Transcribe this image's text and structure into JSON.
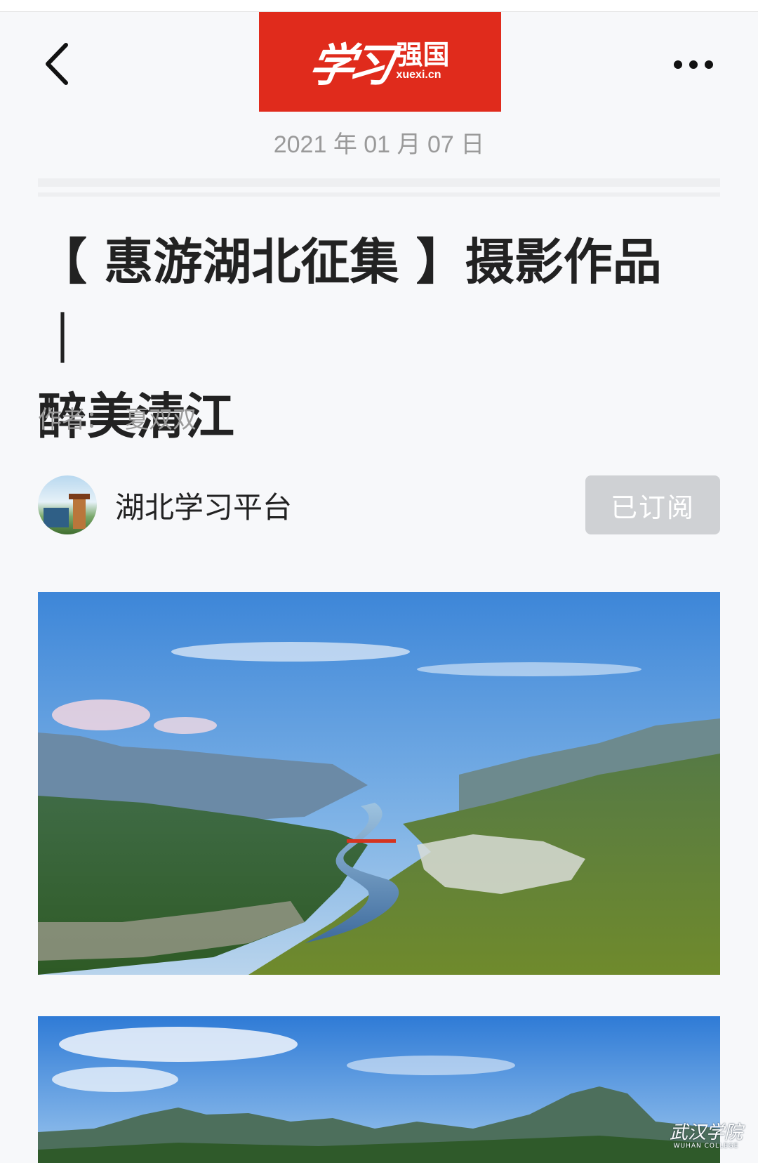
{
  "header": {
    "logo_script": "学习",
    "logo_cn": "强国",
    "logo_en": "xuexi.cn",
    "date": "2021 年 01 月 07 日"
  },
  "article": {
    "title_line1": "【 惠游湖北征集 】摄影作品 ｜",
    "title_line2": "醉美清江",
    "author_label": "作者：",
    "author_name": "夏双双"
  },
  "channel": {
    "name": "湖北学习平台",
    "subscribe_label": "已订阅"
  },
  "watermark": {
    "cn": "武汉学院",
    "en": "WUHAN COLLEGE"
  },
  "colors": {
    "logo_red": "#e02b1c",
    "subscribed_gray": "#cfd1d4",
    "meta_gray": "#9a9a9a"
  },
  "icons": [
    "back-arrow-icon",
    "more-dots-icon"
  ]
}
